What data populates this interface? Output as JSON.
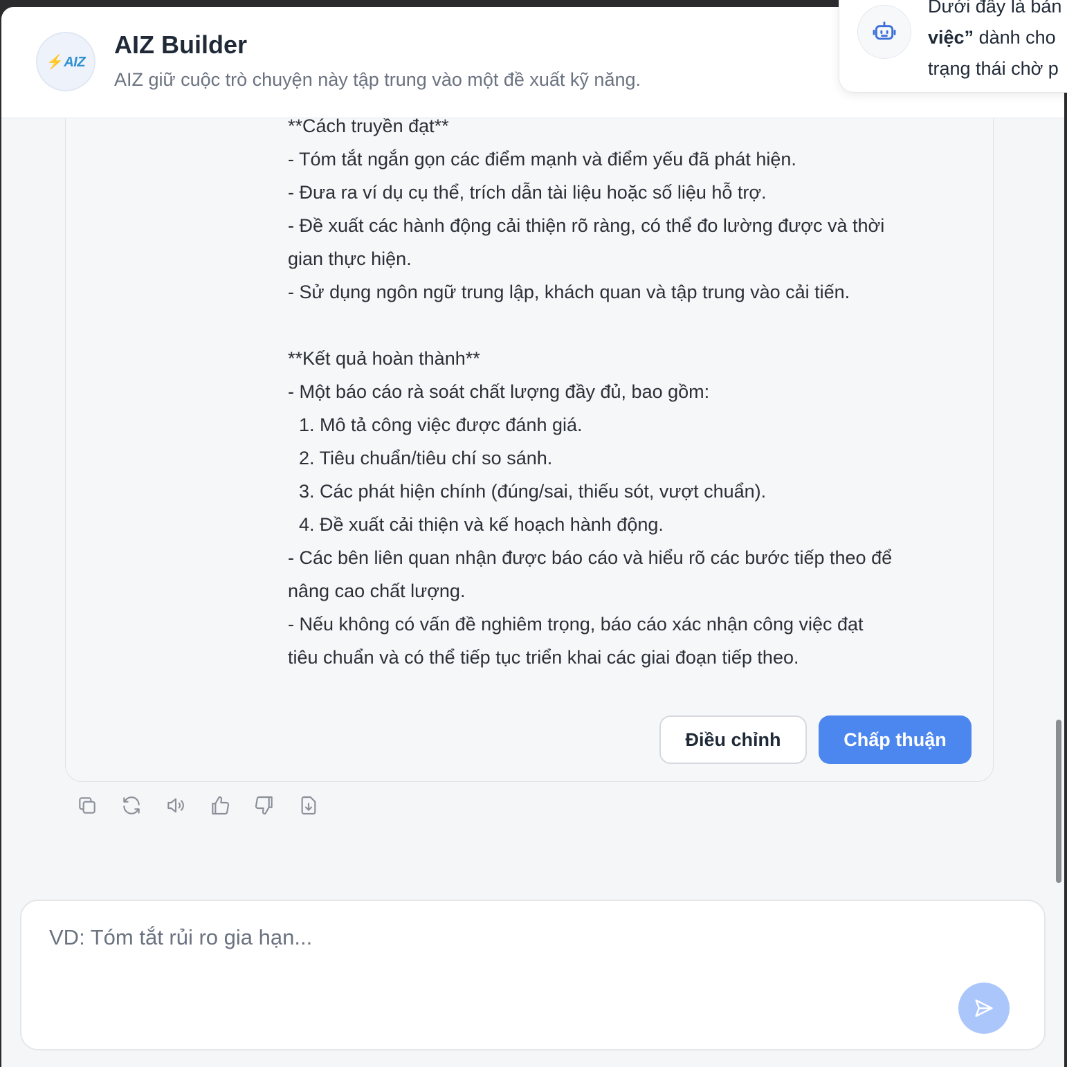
{
  "header": {
    "logo_text": "AIZ",
    "title": "AIZ Builder",
    "subtitle": "AIZ giữ cuộc trò chuyện này tập trung vào một đề xuất kỹ năng."
  },
  "toast": {
    "line1": "Dưới đây là bản",
    "line2_bold": "việc”",
    "line2_rest": " dành cho",
    "line3": "trạng thái chờ p"
  },
  "message": {
    "lines": [
      "**Cách truyền đạt**",
      "- Tóm tắt ngắn gọn các điểm mạnh và điểm yếu đã phát hiện.",
      "- Đưa ra ví dụ cụ thể, trích dẫn tài liệu hoặc số liệu hỗ trợ.",
      "- Đề xuất các hành động cải thiện rõ ràng, có thể đo lường được và thời",
      "gian thực hiện.",
      "- Sử dụng ngôn ngữ trung lập, khách quan và tập trung vào cải tiến.",
      "",
      "**Kết quả hoàn thành**",
      "- Một báo cáo rà soát chất lượng đầy đủ, bao gồm:",
      "1. Mô tả công việc được đánh giá.",
      "2. Tiêu chuẩn/tiêu chí so sánh.",
      "3. Các phát hiện chính (đúng/sai, thiếu sót, vượt chuẩn).",
      "4. Đề xuất cải thiện và kế hoạch hành động.",
      "- Các bên liên quan nhận được báo cáo và hiểu rõ các bước tiếp theo để",
      "nâng cao chất lượng.",
      "- Nếu không có vấn đề nghiêm trọng, báo cáo xác nhận công việc đạt",
      "tiêu chuẩn và có thể tiếp tục triển khai các giai đoạn tiếp theo."
    ],
    "adjust_label": "Điều chỉnh",
    "approve_label": "Chấp thuận"
  },
  "actions": [
    "copy-icon",
    "regenerate-icon",
    "speaker-icon",
    "thumbs-up-icon",
    "thumbs-down-icon",
    "download-icon"
  ],
  "composer": {
    "placeholder": "VD: Tóm tắt rủi ro gia hạn...",
    "value": ""
  },
  "colors": {
    "accent": "#4c86ef",
    "send_disabled": "#aac6fb"
  }
}
